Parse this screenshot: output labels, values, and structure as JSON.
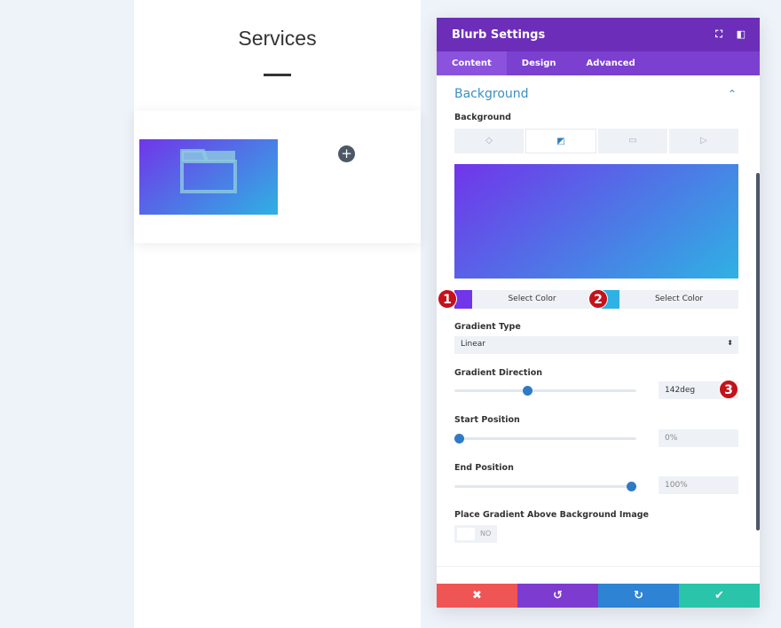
{
  "page": {
    "title": "Services"
  },
  "panel": {
    "title": "Blurb Settings",
    "tabs": [
      "Content",
      "Design",
      "Advanced"
    ],
    "section": "Background",
    "background_label": "Background",
    "bg_types": [
      "paint-bucket-icon",
      "gradient-icon",
      "image-icon",
      "video-icon"
    ],
    "color1": {
      "label": "Select Color",
      "color": "#7135ea"
    },
    "color2": {
      "label": "Select Color",
      "color": "#2fb1e3"
    },
    "gradient_type_label": "Gradient Type",
    "gradient_type": "Linear",
    "direction_label": "Gradient Direction",
    "direction": "142deg",
    "direction_fraction": 0.4,
    "start_label": "Start Position",
    "start": "0%",
    "end_label": "End Position",
    "end": "100%",
    "place_label": "Place Gradient Above Background Image",
    "place_value": "NO",
    "badges": [
      "1",
      "2",
      "3"
    ]
  },
  "colors": {
    "header": "#6c2eb9",
    "cancel": "#ef5555",
    "undo": "#7e3bd0",
    "redo": "#2e83d4",
    "save": "#29c4a9"
  }
}
